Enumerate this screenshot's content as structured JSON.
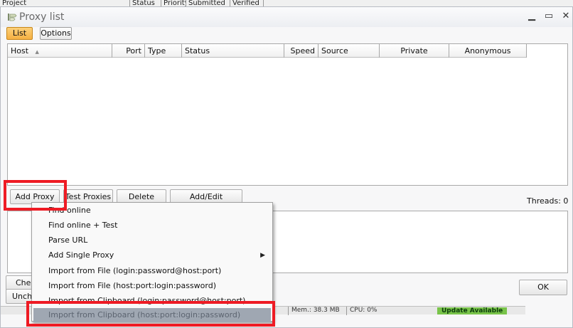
{
  "background_app": {
    "column_labels": [
      "Project",
      "Status",
      "Priority",
      "Submitted",
      "Verified"
    ]
  },
  "window": {
    "title": "Proxy list",
    "controls": {
      "close": "✕",
      "maximize": "▭",
      "minimize": "▁"
    }
  },
  "tabs": {
    "list": "List",
    "options": "Options"
  },
  "grid": {
    "columns": [
      "Host",
      "Port",
      "Type",
      "Status",
      "Speed",
      "Source",
      "Private",
      "Anonymous"
    ],
    "sort_indicator": "▲"
  },
  "toolbar": {
    "add_proxy": "Add Proxy",
    "test_proxies": "Test Proxies",
    "delete": "Delete",
    "add_edit_proxysites": "Add/Edit ProxySites",
    "threads": "Threads: 0"
  },
  "context_menu": {
    "items": [
      "Find online",
      "Find online + Test",
      "Parse URL",
      "Add Single Proxy",
      "Import from File (login:password@host:port)",
      "Import from File (host:port:login:password)",
      "Import from Clipboard (login:password@host:port)",
      "Import from Clipboard (host:port:login:password)"
    ],
    "selected_index": 7,
    "submenu_arrow": "▶"
  },
  "bottom": {
    "check_label": "Chec",
    "uncheck_label": "Unche",
    "ok_label": "OK"
  },
  "status_bar": {
    "mem": "Mem.: 38.3 MB",
    "cpu": "CPU: 0%",
    "update": "Update Available"
  },
  "colors": {
    "highlight_red": "#ee1b24",
    "active_tab": "#f5b042",
    "menu_selected": "#9fa7b2"
  }
}
